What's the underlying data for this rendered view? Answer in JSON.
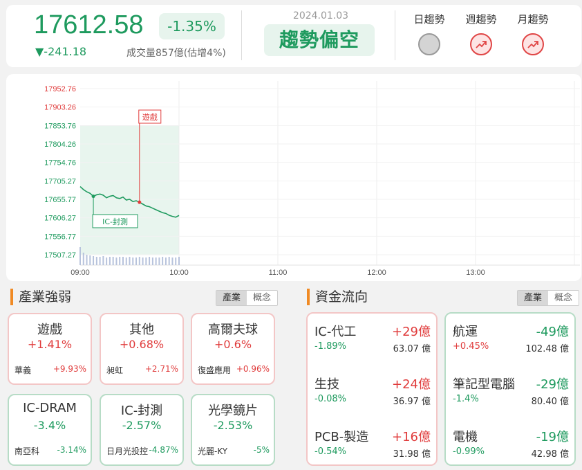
{
  "header": {
    "index": "17612.58",
    "percent": "-1.35%",
    "change": "▼-241.18",
    "volume": "成交量857億(估增4%)",
    "date": "2024.01.03",
    "trend_label": "趨勢偏空",
    "trends": [
      {
        "label": "日趨勢",
        "state": "neutral"
      },
      {
        "label": "週趨勢",
        "state": "up"
      },
      {
        "label": "月趨勢",
        "state": "up"
      }
    ]
  },
  "chart_data": {
    "type": "line",
    "y_ticks": [
      "17952.76",
      "17903.26",
      "17853.76",
      "17804.26",
      "17754.76",
      "17705.27",
      "17655.77",
      "17606.27",
      "17556.77",
      "17507.27"
    ],
    "y_tick_values": [
      17952.76,
      17903.26,
      17853.76,
      17804.26,
      17754.76,
      17705.27,
      17655.77,
      17606.27,
      17556.77,
      17507.27
    ],
    "reference_value": 17853.76,
    "x_ticks": [
      "09:00",
      "10:00",
      "11:00",
      "12:00",
      "13:00"
    ],
    "ylim": [
      17507.27,
      17952.76
    ],
    "series": [
      {
        "x": [
          "09:00",
          "09:02",
          "09:04",
          "09:06",
          "09:08",
          "09:10",
          "09:12",
          "09:14",
          "09:16",
          "09:18",
          "09:20",
          "09:22",
          "09:24",
          "09:26",
          "09:28",
          "09:30",
          "09:32",
          "09:34",
          "09:36",
          "09:38",
          "09:40",
          "09:42",
          "09:44",
          "09:46",
          "09:48",
          "09:50",
          "09:52",
          "09:54",
          "09:56",
          "09:58",
          "10:00"
        ],
        "values": [
          17690,
          17682,
          17676,
          17672,
          17664,
          17668,
          17670,
          17667,
          17660,
          17664,
          17666,
          17660,
          17658,
          17662,
          17654,
          17656,
          17650,
          17652,
          17648,
          17643,
          17638,
          17636,
          17632,
          17628,
          17624,
          17620,
          17618,
          17613,
          17610,
          17608,
          17612.58
        ]
      }
    ],
    "volume_values": [
      26,
      18,
      15,
      14,
      13,
      12,
      12,
      13,
      11,
      12,
      12,
      11,
      12,
      12,
      11,
      12,
      11,
      11,
      12,
      11,
      11,
      12,
      11,
      11,
      11,
      12,
      11,
      12,
      11,
      11,
      12
    ],
    "annotations": [
      {
        "label": "遊戲",
        "x": "09:36",
        "direction": "down"
      },
      {
        "label": "IC-封測",
        "x": "09:08",
        "direction": "up"
      }
    ]
  },
  "industry": {
    "title": "產業強弱",
    "toggle": [
      "產業",
      "概念"
    ],
    "cards": [
      {
        "name": "遊戲",
        "pct": "+1.41%",
        "stock": "華義",
        "stock_pct": "+9.93%",
        "tone": "red"
      },
      {
        "name": "其他",
        "pct": "+0.68%",
        "stock": "昶虹",
        "stock_pct": "+2.71%",
        "tone": "red"
      },
      {
        "name": "高爾夫球",
        "pct": "+0.6%",
        "stock": "復盛應用",
        "stock_pct": "+0.96%",
        "tone": "red"
      },
      {
        "name": "IC-DRAM",
        "pct": "-3.4%",
        "stock": "南亞科",
        "stock_pct": "-3.14%",
        "tone": "green"
      },
      {
        "name": "IC-封測",
        "pct": "-2.57%",
        "stock": "日月光投控",
        "stock_pct": "-4.87%",
        "tone": "green"
      },
      {
        "name": "光學鏡片",
        "pct": "-2.53%",
        "stock": "光麗-KY",
        "stock_pct": "-5%",
        "tone": "green"
      }
    ]
  },
  "flow": {
    "title": "資金流向",
    "toggle": [
      "產業",
      "概念"
    ],
    "inflow": [
      {
        "name": "IC-代工",
        "amount": "+29億",
        "pct": "-1.89%",
        "vol": "63.07 億"
      },
      {
        "name": "生技",
        "amount": "+24億",
        "pct": "-0.08%",
        "vol": "36.97 億"
      },
      {
        "name": "PCB-製造",
        "amount": "+16億",
        "pct": "-0.54%",
        "vol": "31.98 億"
      }
    ],
    "outflow": [
      {
        "name": "航運",
        "amount": "-49億",
        "pct": "+0.45%",
        "vol": "102.48 億"
      },
      {
        "name": "筆記型電腦",
        "amount": "-29億",
        "pct": "-1.4%",
        "vol": "80.40 億"
      },
      {
        "name": "電機",
        "amount": "-19億",
        "pct": "-0.99%",
        "vol": "42.98 億"
      }
    ]
  },
  "colors": {
    "up": "#e03c3c",
    "down": "#1e9a5e",
    "accent": "#f08a24"
  }
}
